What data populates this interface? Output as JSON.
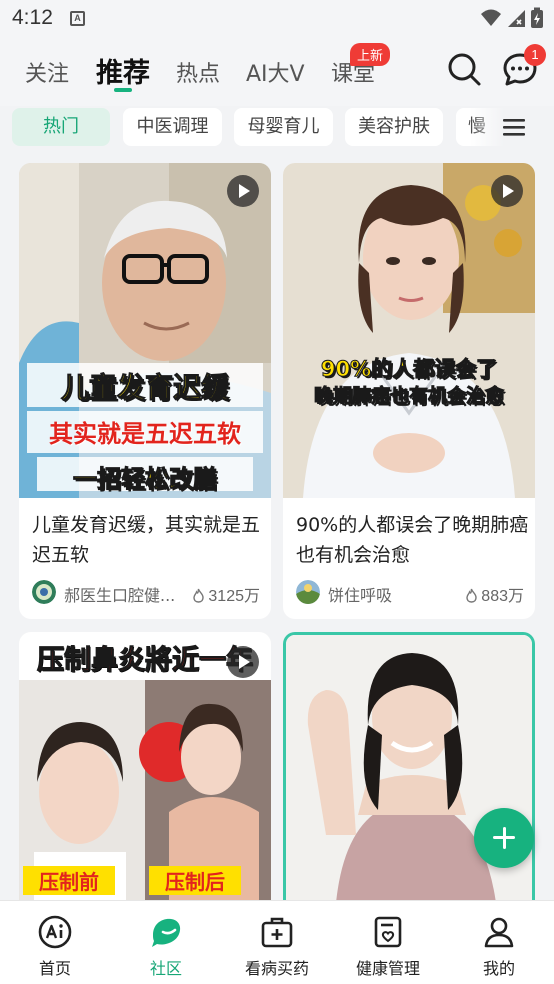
{
  "status_bar": {
    "time": "4:12",
    "app_icon_letter": "A"
  },
  "top_tabs": {
    "items": [
      "关注",
      "推荐",
      "热点",
      "AI大V",
      "课堂"
    ],
    "active_index": 1,
    "new_badge": "上新",
    "message_count": "1"
  },
  "categories": {
    "items": [
      "热门",
      "中医调理",
      "母婴育儿",
      "美容护肤",
      "慢"
    ],
    "active_index": 0
  },
  "feed": [
    {
      "title": "儿童发育迟缓，其实就是五迟五软",
      "overlay_lines": [
        "儿童发育迟缓",
        "其实就是五迟五软",
        "一招轻松改膳"
      ],
      "author": "郝医生口腔健...",
      "views": "3125万",
      "has_video": true
    },
    {
      "title": "90%的人都误会了晚期肺癌也有机会治愈",
      "overlay_lines": [
        "90%的人都误会了",
        "晚期肺癌也有机会治愈"
      ],
      "author": "饼住呼吸",
      "views": "883万",
      "has_video": true
    },
    {
      "overlay_lines": [
        "压制鼻炎將近一年",
        "压制前",
        "压制后"
      ],
      "has_video": true
    },
    {
      "has_video": false
    }
  ],
  "bottom_nav": {
    "items": [
      "首页",
      "社区",
      "看病买药",
      "健康管理",
      "我的"
    ],
    "active_index": 1
  },
  "colors": {
    "accent": "#17b27f",
    "badge": "#ef3b36",
    "overlay_yellow": "#ffe000"
  }
}
